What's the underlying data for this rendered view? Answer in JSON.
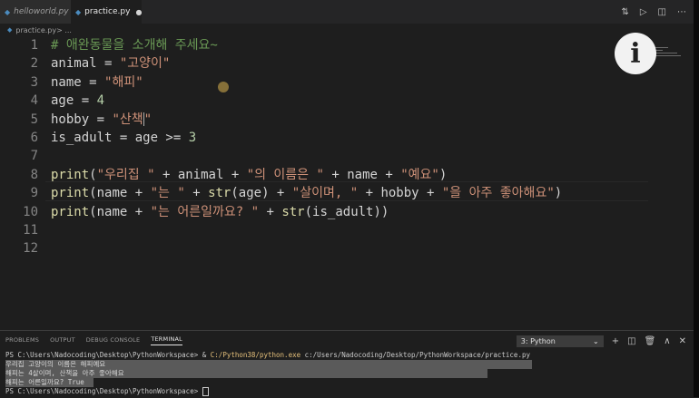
{
  "tabs": [
    {
      "label": "helloworld.py",
      "modified": false
    },
    {
      "label": "practice.py",
      "modified": true,
      "dot": "●"
    }
  ],
  "tab_icons": [
    "⇅",
    "▷",
    "◫",
    "⋯"
  ],
  "breadcrumb": {
    "file": "practice.py",
    "sep": " > ..."
  },
  "editor": {
    "line_numbers": [
      "1",
      "2",
      "3",
      "4",
      "5",
      "6",
      "7",
      "8",
      "9",
      "10",
      "11",
      "12"
    ],
    "lines": [
      [
        {
          "t": "cm",
          "v": "# 애완동물을 소개해 주세요~"
        }
      ],
      [
        {
          "t": "va",
          "v": "animal = "
        },
        {
          "t": "st",
          "v": "\"고양이\""
        }
      ],
      [
        {
          "t": "va",
          "v": "name = "
        },
        {
          "t": "st",
          "v": "\"해피\""
        }
      ],
      [
        {
          "t": "va",
          "v": "age = "
        },
        {
          "t": "nm",
          "v": "4"
        }
      ],
      [
        {
          "t": "va",
          "v": "hobby = "
        },
        {
          "t": "st",
          "v": "\"산책"
        },
        {
          "t": "cursor",
          "v": ""
        },
        {
          "t": "st",
          "v": "\""
        }
      ],
      [
        {
          "t": "va",
          "v": "is_adult = age >= "
        },
        {
          "t": "nm",
          "v": "3"
        }
      ],
      [],
      [
        {
          "t": "fn",
          "v": "print"
        },
        {
          "t": "va",
          "v": "("
        },
        {
          "t": "st",
          "v": "\"우리집 \""
        },
        {
          "t": "va",
          "v": " + animal + "
        },
        {
          "t": "st",
          "v": "\"의 이름은 \""
        },
        {
          "t": "va",
          "v": " + name + "
        },
        {
          "t": "st",
          "v": "\"예요\""
        },
        {
          "t": "va",
          "v": ")"
        }
      ],
      [
        {
          "t": "fn",
          "v": "print"
        },
        {
          "t": "va",
          "v": "(name + "
        },
        {
          "t": "st",
          "v": "\"는 \""
        },
        {
          "t": "va",
          "v": " + "
        },
        {
          "t": "fn",
          "v": "str"
        },
        {
          "t": "va",
          "v": "(age) + "
        },
        {
          "t": "st",
          "v": "\"살이며, \""
        },
        {
          "t": "va",
          "v": " + hobby + "
        },
        {
          "t": "st",
          "v": "\"을 아주 좋아해요\""
        },
        {
          "t": "va",
          "v": ")"
        }
      ],
      [
        {
          "t": "fn",
          "v": "print"
        },
        {
          "t": "va",
          "v": "(name + "
        },
        {
          "t": "st",
          "v": "\"는 어른일까요? \""
        },
        {
          "t": "va",
          "v": " + "
        },
        {
          "t": "fn",
          "v": "str"
        },
        {
          "t": "va",
          "v": "(is_adult))"
        }
      ],
      [],
      []
    ]
  },
  "overlay": {
    "info_glyph": "i"
  },
  "panel": {
    "tabs": [
      "PROBLEMS",
      "OUTPUT",
      "DEBUG CONSOLE",
      "TERMINAL"
    ],
    "active_tab": "TERMINAL",
    "terminal_select": "3: Python",
    "select_chevron": "⌄",
    "controls": [
      "+",
      "◫",
      "🗑",
      "∧",
      "✕"
    ]
  },
  "terminal": {
    "cmd_prompt": "PS C:\\Users\\Nadocoding\\Desktop\\PythonWorkspace> & ",
    "cmd_exe": "C:/Python38/python.exe",
    "cmd_arg": " c:/Users/Nadocoding/Desktop/PythonWorkspace/practice.py",
    "output": [
      "우리집 고양이의 이름은 해피예요",
      "해피는 4살이며, 산책을 아주 좋아해요",
      "해피는 어른일까요? True"
    ],
    "final_prompt": "PS C:\\Users\\Nadocoding\\Desktop\\PythonWorkspace> "
  }
}
